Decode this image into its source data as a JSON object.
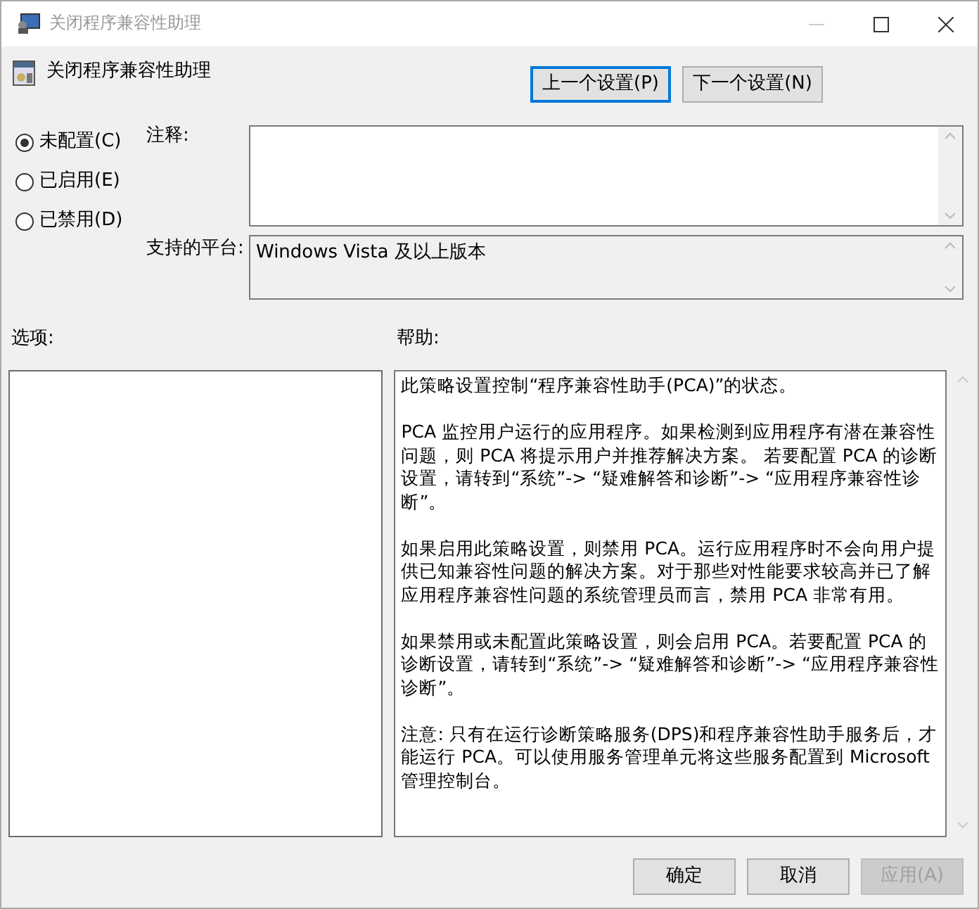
{
  "window": {
    "title": "关闭程序兼容性助理"
  },
  "header": {
    "title": "关闭程序兼容性助理"
  },
  "nav_buttons": [
    {
      "label": "上一个设置(P)",
      "focused": true
    },
    {
      "label": "下一个设置(N)",
      "focused": false
    }
  ],
  "options": [
    {
      "label": "未配置(C)",
      "selected": true
    },
    {
      "label": "已启用(E)",
      "selected": false
    },
    {
      "label": "已禁用(D)",
      "selected": false
    }
  ],
  "comment": {
    "label": "注释:"
  },
  "platform": {
    "label": "支持的平台:",
    "value": "Windows Vista 及以上版本"
  },
  "options_panel": {
    "label": "选项:"
  },
  "help": {
    "label": "帮助:",
    "paragraphs": [
      "此策略设置控制“程序兼容性助手(PCA)”的状态。",
      "PCA 监控用户运行的应用程序。如果检测到应用程序有潜在兼容性问题，则 PCA 将提示用户并推荐解决方案。 若要配置 PCA 的诊断设置，请转到“系统”-> “疑难解答和诊断”-> “应用程序兼容性诊断”。",
      "如果启用此策略设置，则禁用 PCA。运行应用程序时不会向用户提供已知兼容性问题的解决方案。对于那些对性能要求较高并已了解应用程序兼容性问题的系统管理员而言，禁用 PCA 非常有用。",
      "如果禁用或未配置此策略设置，则会启用 PCA。若要配置 PCA 的诊断设置，请转到“系统”-> “疑难解答和诊断”-> “应用程序兼容性诊断”。",
      "注意: 只有在运行诊断策略服务(DPS)和程序兼容性助手服务后，才能运行 PCA。可以使用服务管理单元将这些服务配置到 Microsoft 管理控制台。"
    ]
  },
  "buttons": [
    {
      "label": "确定",
      "disabled": false
    },
    {
      "label": "取消",
      "disabled": false
    },
    {
      "label": "应用(A)",
      "disabled": true
    }
  ]
}
